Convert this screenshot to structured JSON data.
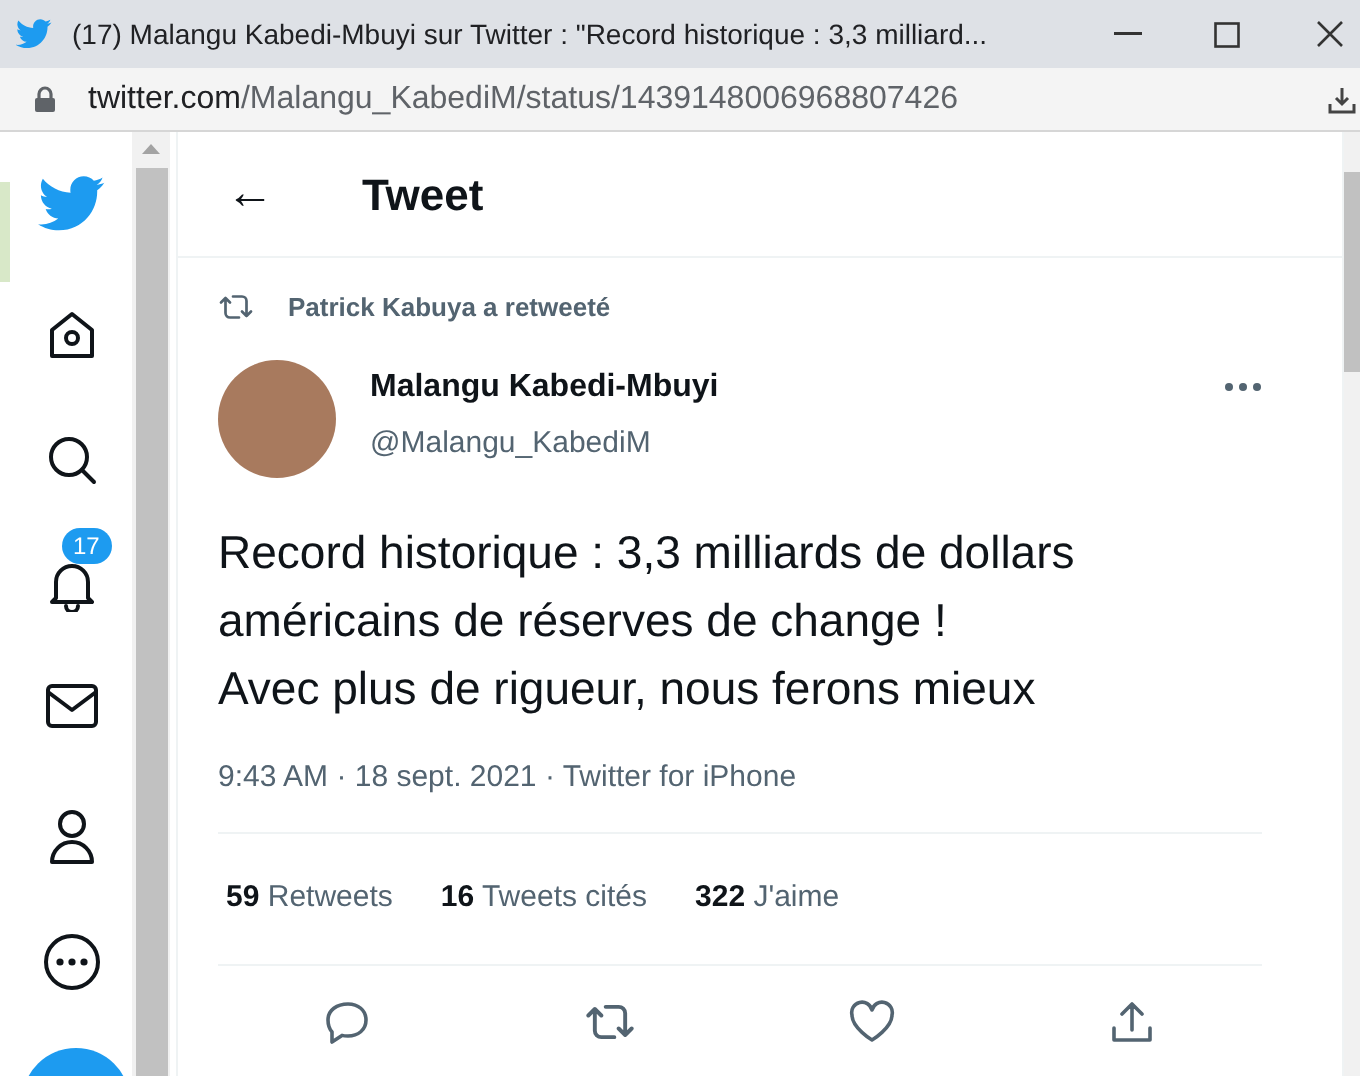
{
  "window": {
    "title": "(17) Malangu Kabedi-Mbuyi sur Twitter : \"Record historique : 3,3 milliard..."
  },
  "address_bar": {
    "host": "twitter.com",
    "path": "/Malangu_KabediM/status/1439148006968807426"
  },
  "sidebar": {
    "notifications_badge": "17"
  },
  "header": {
    "back": "←",
    "title": "Tweet"
  },
  "tweet": {
    "retweeted_by": "Patrick Kabuya a retweeté",
    "author_name": "Malangu Kabedi-Mbuyi",
    "author_handle": "@Malangu_KabediM",
    "text_lines": [
      "Record historique : 3,3 milliards de dollars",
      "américains de réserves de change !",
      "Avec plus de rigueur, nous ferons mieux"
    ],
    "meta": "9:43 AM · 18 sept. 2021 · Twitter for iPhone",
    "stats": [
      {
        "count": "59",
        "label": "Retweets"
      },
      {
        "count": "16",
        "label": "Tweets cités"
      },
      {
        "count": "322",
        "label": "J'aime"
      }
    ]
  }
}
